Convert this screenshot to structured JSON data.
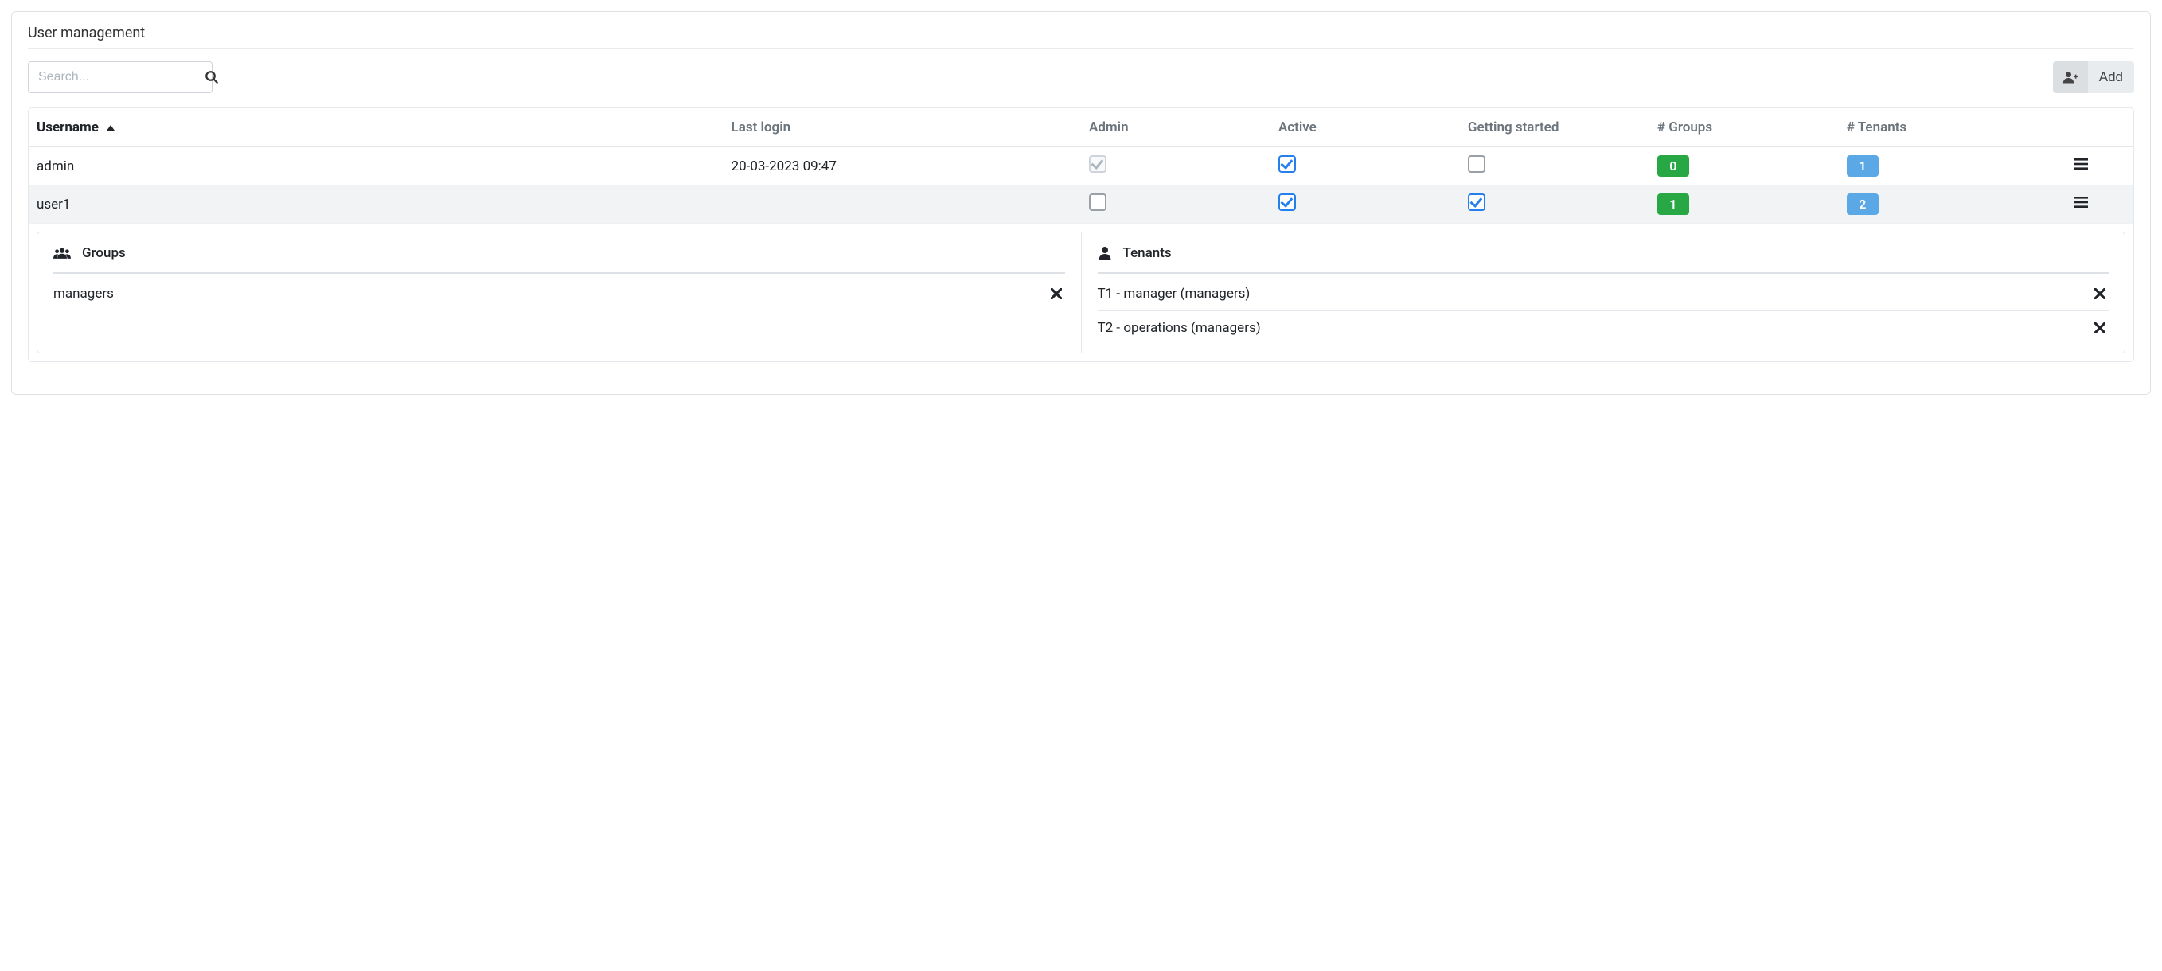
{
  "page": {
    "title": "User management"
  },
  "toolbar": {
    "search_placeholder": "Search...",
    "add_label": "Add"
  },
  "table": {
    "columns": {
      "username": "Username",
      "last_login": "Last login",
      "admin": "Admin",
      "active": "Active",
      "getting_started": "Getting started",
      "groups": "# Groups",
      "tenants": "# Tenants"
    },
    "sort": {
      "column": "username",
      "dir": "asc"
    },
    "rows": [
      {
        "username": "admin",
        "last_login": "20-03-2023 09:47",
        "admin": true,
        "admin_disabled": true,
        "active": true,
        "getting_started": false,
        "groups_count": "0",
        "tenants_count": "1"
      },
      {
        "username": "user1",
        "last_login": "",
        "admin": false,
        "admin_disabled": false,
        "active": true,
        "getting_started": true,
        "groups_count": "1",
        "tenants_count": "2"
      }
    ]
  },
  "detail": {
    "groups": {
      "title": "Groups",
      "items": [
        {
          "name": "managers"
        }
      ]
    },
    "tenants": {
      "title": "Tenants",
      "items": [
        {
          "name": "T1 - manager (managers)"
        },
        {
          "name": "T2 - operations (managers)"
        }
      ]
    }
  }
}
